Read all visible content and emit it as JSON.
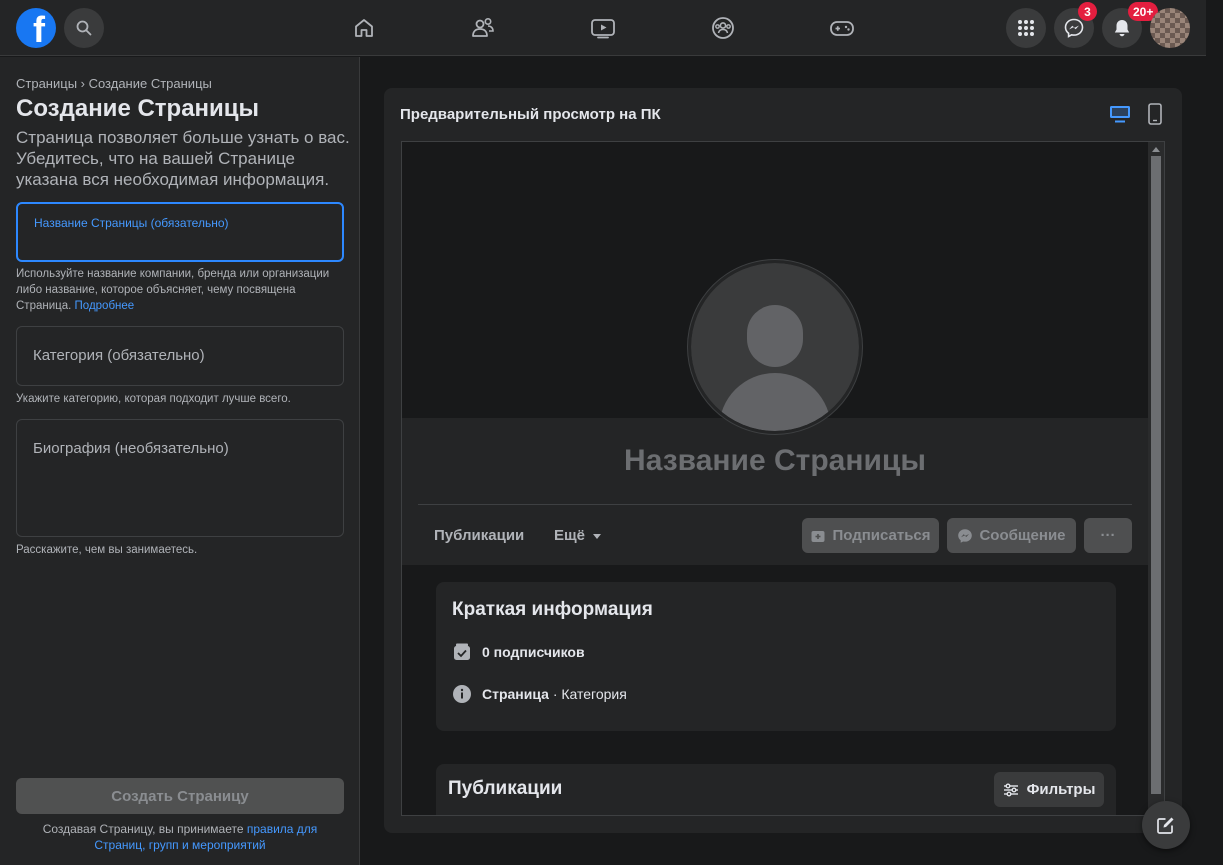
{
  "topbar": {
    "logo": "f",
    "icons": [
      "search-icon",
      "home-icon",
      "friends-icon",
      "watch-icon",
      "groups-icon",
      "gaming-icon",
      "menu-grid-icon",
      "messenger-icon",
      "notifications-icon"
    ],
    "messenger_badge": "3",
    "notifications_badge": "20+"
  },
  "sidebar": {
    "breadcrumb": "Страницы › Создание Страницы",
    "title": "Создание Страницы",
    "intro": "Страница позволяет больше узнать о вас. Убедитесь, что на вашей Странице указана вся необходимая информация.",
    "name_field": {
      "label": "Название Страницы (обязательно)",
      "value": ""
    },
    "name_helper": "Используйте название компании, бренда или организации либо название, которое объясняет, чему посвящена Страница.",
    "name_helper_link": "Подробнее",
    "category_field": {
      "label": "Категория (обязательно)"
    },
    "category_helper": "Укажите категорию, которая подходит лучше всего.",
    "bio_field": {
      "label": "Биография (необязательно)"
    },
    "bio_helper": "Расскажите, чем вы занимаетесь.",
    "create_button": "Создать Страницу",
    "terms_text": "Создавая Страницу, вы принимаете",
    "terms_link": "правила для Страниц, групп и мероприятий"
  },
  "preview": {
    "header": "Предварительный просмотр на ПК",
    "page_name": "Название Страницы",
    "tabs": {
      "posts": "Публикации",
      "more": "Ещё"
    },
    "buttons": {
      "follow": "Подписаться",
      "message": "Сообщение",
      "more": "···"
    },
    "intro_card": {
      "title": "Краткая информация",
      "followers": "0 подписчиков",
      "type_bold": "Страница",
      "type_rest": " · Категория"
    },
    "posts_card": {
      "title": "Публикации",
      "filters": "Фильтры"
    }
  },
  "colors": {
    "accent": "#1877f2",
    "link": "#4599ff",
    "badge": "#e41e3f",
    "background": "#18191a",
    "surface": "#242526"
  }
}
